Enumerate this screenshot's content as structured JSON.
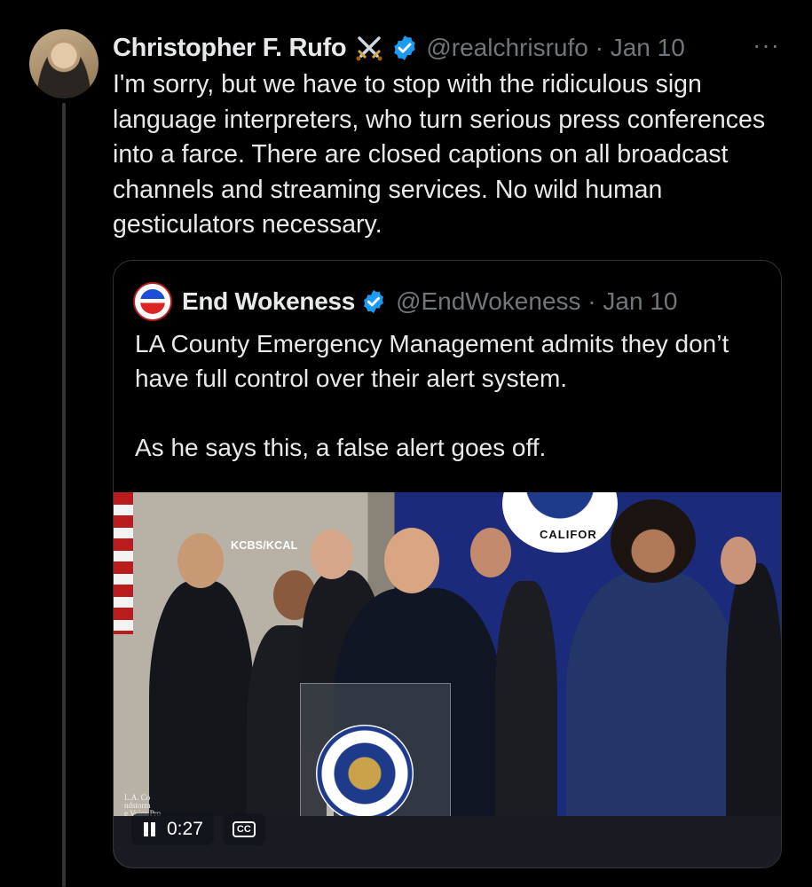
{
  "tweet": {
    "author_name": "Christopher F. Rufo",
    "author_emoji": "crossed-swords",
    "handle_and_date": "@realchrisrufo · Jan 10",
    "more_label": "···",
    "text": "I'm sorry, but we have to stop with the ridiculous sign language interpreters, who turn serious press conferences into a farce. There are closed captions on all broadcast channels and streaming services. No wild human gesticulators necessary."
  },
  "quote": {
    "author_name": "End Wokeness",
    "handle_and_date": "@EndWokeness · Jan 10",
    "paragraph_1": "LA County Emergency Management admits they don’t have full control over their alert system.",
    "paragraph_2": "As he says this, a false alert goes off.",
    "video": {
      "watermark": "KCBS/KCAL",
      "seal_top_text": "CALIFOR",
      "corner_text": "L.A. Co\nndstorm\ne Voice Pro",
      "time": "0:27",
      "cc_label": "CC",
      "state": "playing"
    }
  },
  "colors": {
    "background": "#000000",
    "text_primary": "#e7e9ea",
    "text_secondary": "#71767b",
    "border": "#2f3336",
    "verified_blue": "#1d9bf0"
  }
}
